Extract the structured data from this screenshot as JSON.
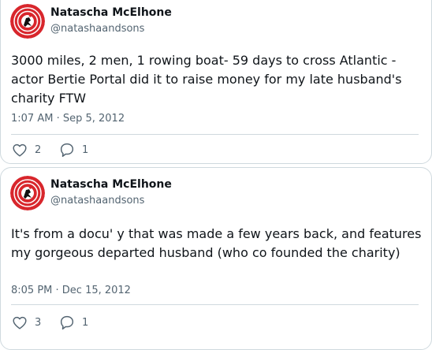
{
  "colors": {
    "text_primary": "#0f1419",
    "text_secondary": "#536471",
    "border": "#cfd9de",
    "avatar_red": "#d8262c"
  },
  "tweets": [
    {
      "author_name": "Natascha McElhone",
      "author_handle": "@natashaandsons",
      "avatar_icon": "red-spiral-avatar",
      "text": "3000 miles, 2 men, 1 rowing boat- 59 days to cross Atlantic - actor Bertie Portal did it to raise money for my late husband's charity FTW",
      "timestamp": "1:07 AM · Sep 5, 2012",
      "like_count": "2",
      "reply_count": "1"
    },
    {
      "author_name": "Natascha McElhone",
      "author_handle": "@natashaandsons",
      "avatar_icon": "red-spiral-avatar",
      "text": "It's from a docu' y that was made a few years back, and features my gorgeous departed husband (who co founded the charity)",
      "timestamp": "8:05 PM · Dec 15, 2012",
      "like_count": "3",
      "reply_count": "1"
    }
  ]
}
